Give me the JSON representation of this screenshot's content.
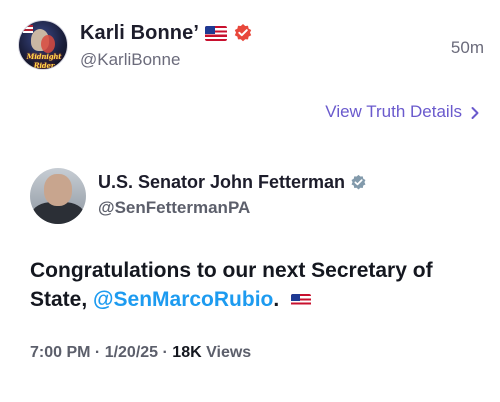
{
  "post": {
    "author": {
      "display_name": "Karli Bonne’",
      "handle": "@KarliBonne",
      "avatar_text": "Midnight Rider",
      "flag": "us-flag-icon",
      "verified_icon": "verified-badge-icon"
    },
    "timestamp": "50m",
    "details_link": "View Truth Details",
    "colors": {
      "accent": "#6a5acd",
      "verified": "#e8473b",
      "mention": "#1d9bf0"
    }
  },
  "tweet": {
    "display_name": "U.S. Senator John Fetterman",
    "handle": "@SenFettermanPA",
    "text_prefix": "Congratulations to our next Secretary of State, ",
    "mention": "@SenMarcoRubio",
    "text_suffix": ".",
    "time": "7:00 PM",
    "date": "1/20/25",
    "views_count": "18K",
    "views_label": "Views",
    "separator": " · "
  }
}
